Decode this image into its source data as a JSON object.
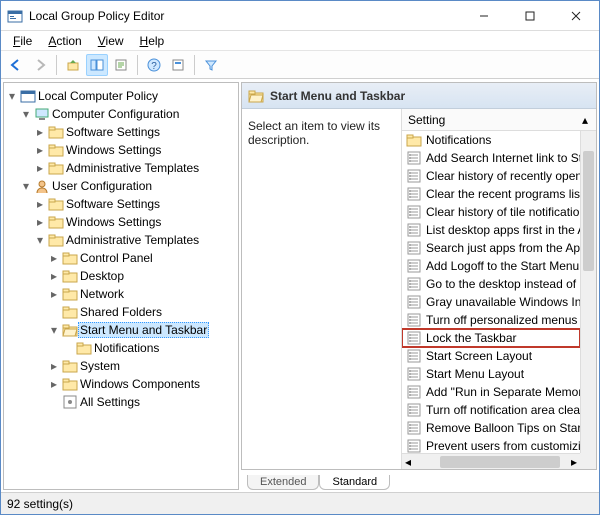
{
  "window": {
    "title": "Local Group Policy Editor"
  },
  "menu": {
    "file": "File",
    "action": "Action",
    "view": "View",
    "help": "Help"
  },
  "tree": {
    "root": "Local Computer Policy",
    "comp_config": "Computer Configuration",
    "cc_software": "Software Settings",
    "cc_windows": "Windows Settings",
    "cc_admin": "Administrative Templates",
    "user_config": "User Configuration",
    "uc_software": "Software Settings",
    "uc_windows": "Windows Settings",
    "uc_admin": "Administrative Templates",
    "control_panel": "Control Panel",
    "desktop": "Desktop",
    "network": "Network",
    "shared_folders": "Shared Folders",
    "start_taskbar": "Start Menu and Taskbar",
    "notifications": "Notifications",
    "system": "System",
    "windows_components": "Windows Components",
    "all_settings": "All Settings"
  },
  "right": {
    "header": "Start Menu and Taskbar",
    "description": "Select an item to view its description.",
    "column": "Setting",
    "items": [
      "Notifications",
      "Add Search Internet link to Start Menu",
      "Clear history of recently opened documents on exit",
      "Clear the recent programs list for new users",
      "Clear history of tile notifications on exit",
      "List desktop apps first in the Apps view",
      "Search just apps from the Apps view",
      "Add Logoff to the Start Menu",
      "Go to the desktop instead of Start when signing in",
      "Gray unavailable Windows Installer programs Start Menu shortcuts",
      "Turn off personalized menus",
      "Lock the Taskbar",
      "Start Screen Layout",
      "Start Menu Layout",
      "Add \"Run in Separate Memory Space\" check box to Run dialog box",
      "Turn off notification area cleanup",
      "Remove Balloon Tips on Start Menu items",
      "Prevent users from customizing their Start Screen"
    ],
    "tabs": {
      "extended": "Extended",
      "standard": "Standard"
    }
  },
  "status": "92 setting(s)"
}
